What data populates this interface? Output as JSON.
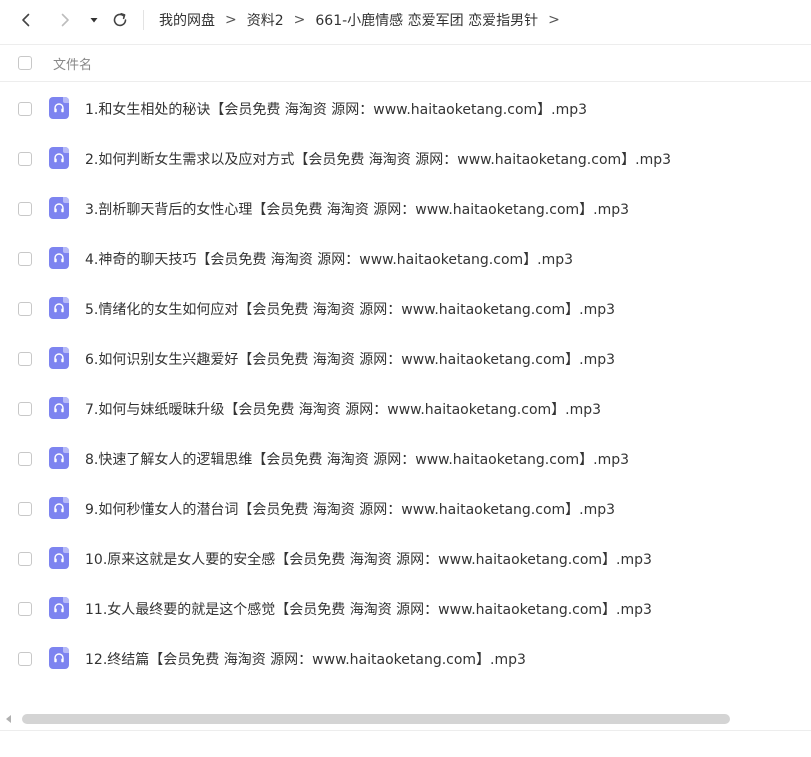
{
  "breadcrumb": [
    "我的网盘",
    "资料2",
    "661-小鹿情感 恋爱军团 恋爱指男针"
  ],
  "breadcrumb_separator": ">",
  "header": {
    "column_name": "文件名"
  },
  "files": [
    "1.和女生相处的秘诀【会员免费 海淘资 源网：www.haitaoketang.com】.mp3",
    "2.如何判断女生需求以及应对方式【会员免费 海淘资 源网：www.haitaoketang.com】.mp3",
    "3.剖析聊天背后的女性心理【会员免费 海淘资 源网：www.haitaoketang.com】.mp3",
    "4.神奇的聊天技巧【会员免费 海淘资 源网：www.haitaoketang.com】.mp3",
    "5.情绪化的女生如何应对【会员免费 海淘资 源网：www.haitaoketang.com】.mp3",
    "6.如何识别女生兴趣爱好【会员免费 海淘资 源网：www.haitaoketang.com】.mp3",
    "7.如何与妹纸暧昧升级【会员免费 海淘资 源网：www.haitaoketang.com】.mp3",
    "8.快速了解女人的逻辑思维【会员免费 海淘资 源网：www.haitaoketang.com】.mp3",
    "9.如何秒懂女人的潜台词【会员免费 海淘资 源网：www.haitaoketang.com】.mp3",
    "10.原来这就是女人要的安全感【会员免费 海淘资 源网：www.haitaoketang.com】.mp3",
    "11.女人最终要的就是这个感觉【会员免费 海淘资 源网：www.haitaoketang.com】.mp3",
    "12.终结篇【会员免费 海淘资 源网：www.haitaoketang.com】.mp3"
  ],
  "icons": {
    "back": "chevron-left-icon",
    "forward": "chevron-right-icon",
    "dropdown": "caret-down-icon",
    "refresh": "refresh-icon",
    "file": "audio-file-icon"
  },
  "colors": {
    "audio_icon": "#7d84f0",
    "text": "#333333",
    "header_text": "#888888"
  }
}
